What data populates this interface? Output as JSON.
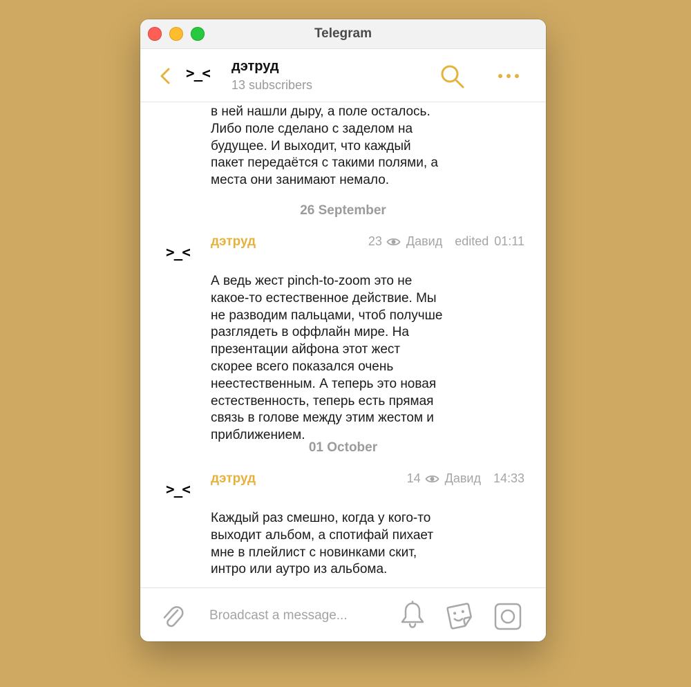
{
  "window": {
    "title": "Telegram"
  },
  "header": {
    "avatar_text": ">_<",
    "channel_name": "дэтруд",
    "subscribers": "13 subscribers",
    "back_icon": "chevron-left-icon",
    "search_icon": "search-icon",
    "more_icon": "more-dots-icon"
  },
  "accent_color": "#E4B23D",
  "messages": [
    {
      "type": "continuation",
      "text": "в ней нашли дыру, а поле осталось.\nЛибо поле сделано с заделом на\nбудущее. И выходит, что каждый\nпакет передаётся с такими полями, а\nместа они занимают немало."
    },
    {
      "type": "date",
      "label": "26 September"
    },
    {
      "type": "post",
      "avatar": ">_<",
      "author": "дэтруд",
      "views": "23",
      "signature": "Давид",
      "edited": "edited",
      "time": "01:11",
      "text": "А ведь жест pinch-to-zoom это не\nкакое-то естественное действие. Мы\nне разводим пальцами, чтоб получше\nразглядеть в оффлайн мире. На\nпрезентации айфона этот жест\nскорее всего показался очень\nнеестественным. А теперь это новая\nестественность, теперь есть прямая\nсвязь в голове между этим жестом и\nприближением."
    },
    {
      "type": "date",
      "label": "01 October"
    },
    {
      "type": "post",
      "avatar": ">_<",
      "author": "дэтруд",
      "views": "14",
      "signature": "Давид",
      "time": "14:33",
      "text": "Каждый раз смешно, когда у кого-то\nвыходит альбом, а спотифай пихает\nмне в плейлист с новинками скит,\nинтро или аутро из альбома."
    }
  ],
  "composer": {
    "placeholder": "Broadcast a message...",
    "attach_icon": "paperclip-icon",
    "bell_icon": "bell-icon",
    "sticker_icon": "sticker-icon",
    "camera_icon": "camera-icon"
  }
}
